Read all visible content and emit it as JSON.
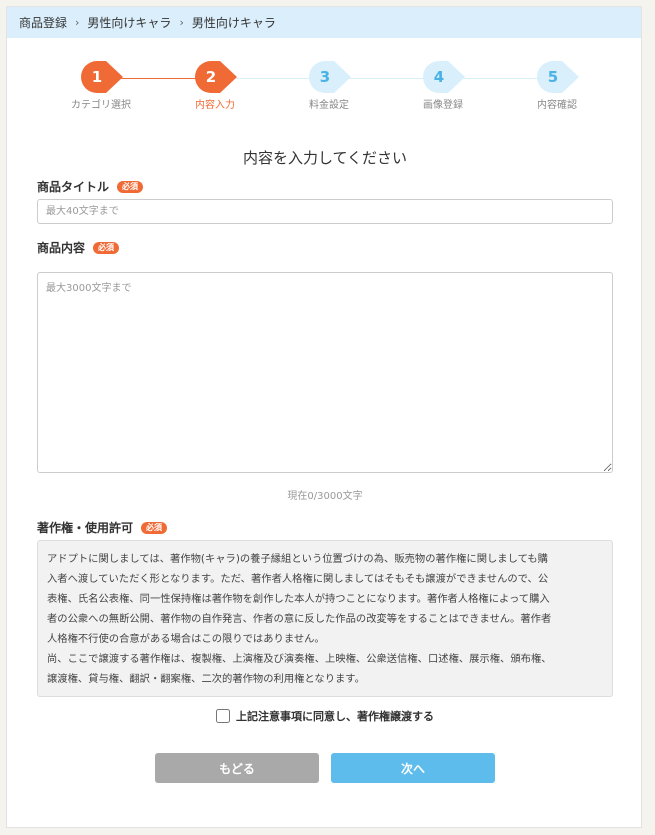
{
  "breadcrumb": [
    "商品登録",
    "男性向けキャラ",
    "男性向けキャラ"
  ],
  "steps": [
    {
      "num": "1",
      "label": "カテゴリ選択",
      "state": "done"
    },
    {
      "num": "2",
      "label": "内容入力",
      "state": "active"
    },
    {
      "num": "3",
      "label": "料金設定",
      "state": "pending"
    },
    {
      "num": "4",
      "label": "画像登録",
      "state": "pending"
    },
    {
      "num": "5",
      "label": "内容確認",
      "state": "pending"
    }
  ],
  "colors": {
    "accent": "#f06a35",
    "pending_bg": "#d9effb",
    "pending_text": "#4bb2e6",
    "next_button": "#5dbcec",
    "back_button": "#a9a9a9"
  },
  "heading": "内容を入力してください",
  "title_field": {
    "label": "商品タイトル",
    "required": "必須",
    "placeholder": "最大40文字まで",
    "value": ""
  },
  "content_field": {
    "label": "商品内容",
    "required": "必須",
    "placeholder": "最大3000文字まで",
    "value": "",
    "counter": "現在0/3000文字"
  },
  "copyright": {
    "label": "著作権・使用許可",
    "required": "必須",
    "text_lines": [
      "アドプトに関しましては、著作物(キャラ)の養子縁組という位置づけの為、販売物の著作権に関しましても購",
      "入者へ渡していただく形となります。ただ、著作者人格権に関しましてはそもそも譲渡ができませんので、公",
      "表権、氏名公表権、同一性保持権は著作物を創作した本人が持つことになります。著作者人格権によって購入",
      "者の公衆への無断公開、著作物の自作発言、作者の意に反した作品の改変等をすることはできません。著作者",
      "人格権不行使の合意がある場合はこの限りではありません。",
      "尚、ここで譲渡する著作権は、複製権、上演権及び演奏権、上映権、公衆送信権、口述権、展示権、頒布権、",
      "譲渡権、貸与権、翻訳・翻案権、二次的著作物の利用権となります。"
    ]
  },
  "agreement": {
    "label": "上記注意事項に同意し、著作権譲渡する",
    "checked": false
  },
  "buttons": {
    "back": "もどる",
    "next": "次へ"
  }
}
